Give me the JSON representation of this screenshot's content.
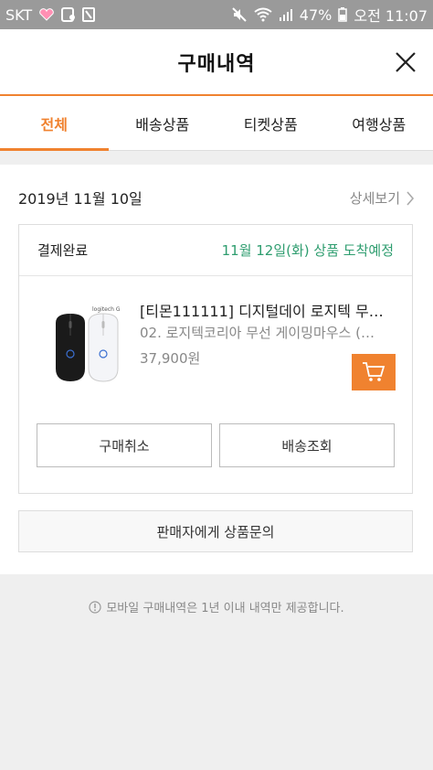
{
  "status_bar": {
    "carrier": "SKT",
    "battery": "47%",
    "time": "오전 11:07"
  },
  "header": {
    "title": "구매내역",
    "close_icon": "close-icon"
  },
  "tabs": [
    {
      "label": "전체",
      "active": true
    },
    {
      "label": "배송상품",
      "active": false
    },
    {
      "label": "티켓상품",
      "active": false
    },
    {
      "label": "여행상품",
      "active": false
    }
  ],
  "order": {
    "date": "2019년 11월 10일",
    "detail_link": "상세보기",
    "status": "결제완료",
    "delivery": "11월 12일(화) 상품 도착예정",
    "product": {
      "name": "[티몬111111] 디지털데이 로지텍 무선 …",
      "option": "02. 로지텍코리아 무선 게이밍마우스 (…",
      "price": "37,900원"
    },
    "actions": {
      "cancel": "구매취소",
      "track": "배송조회"
    },
    "inquiry": "판매자에게 상품문의"
  },
  "footer": {
    "note": "모바일 구매내역은 1년 이내 내역만 제공합니다."
  },
  "colors": {
    "accent": "#f0822f",
    "delivery": "#2e9d6f",
    "status_bar": "#9a9a9a"
  }
}
